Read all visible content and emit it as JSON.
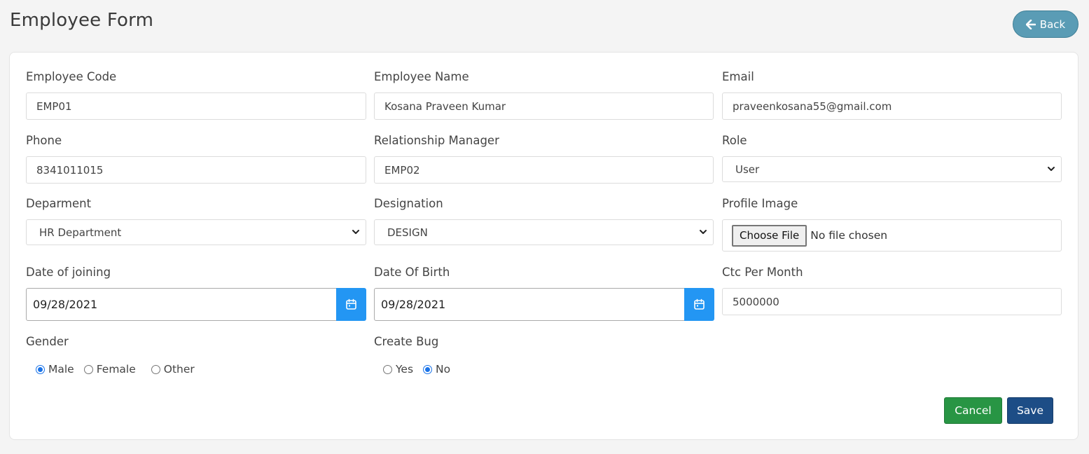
{
  "header": {
    "title": "Employee Form",
    "back_label": "Back"
  },
  "form": {
    "employee_code": {
      "label": "Employee Code",
      "value": "EMP01"
    },
    "employee_name": {
      "label": "Employee Name",
      "value": "Kosana Praveen Kumar"
    },
    "email": {
      "label": "Email",
      "value": "praveenkosana55@gmail.com"
    },
    "phone": {
      "label": "Phone",
      "value": "8341011015"
    },
    "relationship_manager": {
      "label": "Relationship Manager",
      "value": "EMP02"
    },
    "role": {
      "label": "Role",
      "value": "User"
    },
    "department": {
      "label": "Deparment",
      "value": "HR Department"
    },
    "designation": {
      "label": "Designation",
      "value": "DESIGN"
    },
    "profile_image": {
      "label": "Profile Image",
      "button": "Choose File",
      "status": "No file chosen"
    },
    "date_of_joining": {
      "label": "Date of joining",
      "value": "09/28/2021"
    },
    "date_of_birth": {
      "label": "Date Of Birth",
      "value": "09/28/2021"
    },
    "ctc_per_month": {
      "label": "Ctc Per Month",
      "value": "5000000"
    },
    "gender": {
      "label": "Gender",
      "options": [
        "Male",
        "Female",
        "Other"
      ],
      "selected": "Male"
    },
    "create_bug": {
      "label": "Create Bug",
      "options": [
        "Yes",
        "No"
      ],
      "selected": "No"
    }
  },
  "actions": {
    "cancel_label": "Cancel",
    "save_label": "Save"
  },
  "colors": {
    "back": "#5a9cb5",
    "calendar": "#2396f3",
    "cancel": "#289544",
    "save": "#1d4d86",
    "radio_checked": "#1a73e8"
  },
  "icons": {
    "back": "arrow-left-icon",
    "calendar": "calendar-icon",
    "select": "chevron-down-icon"
  }
}
